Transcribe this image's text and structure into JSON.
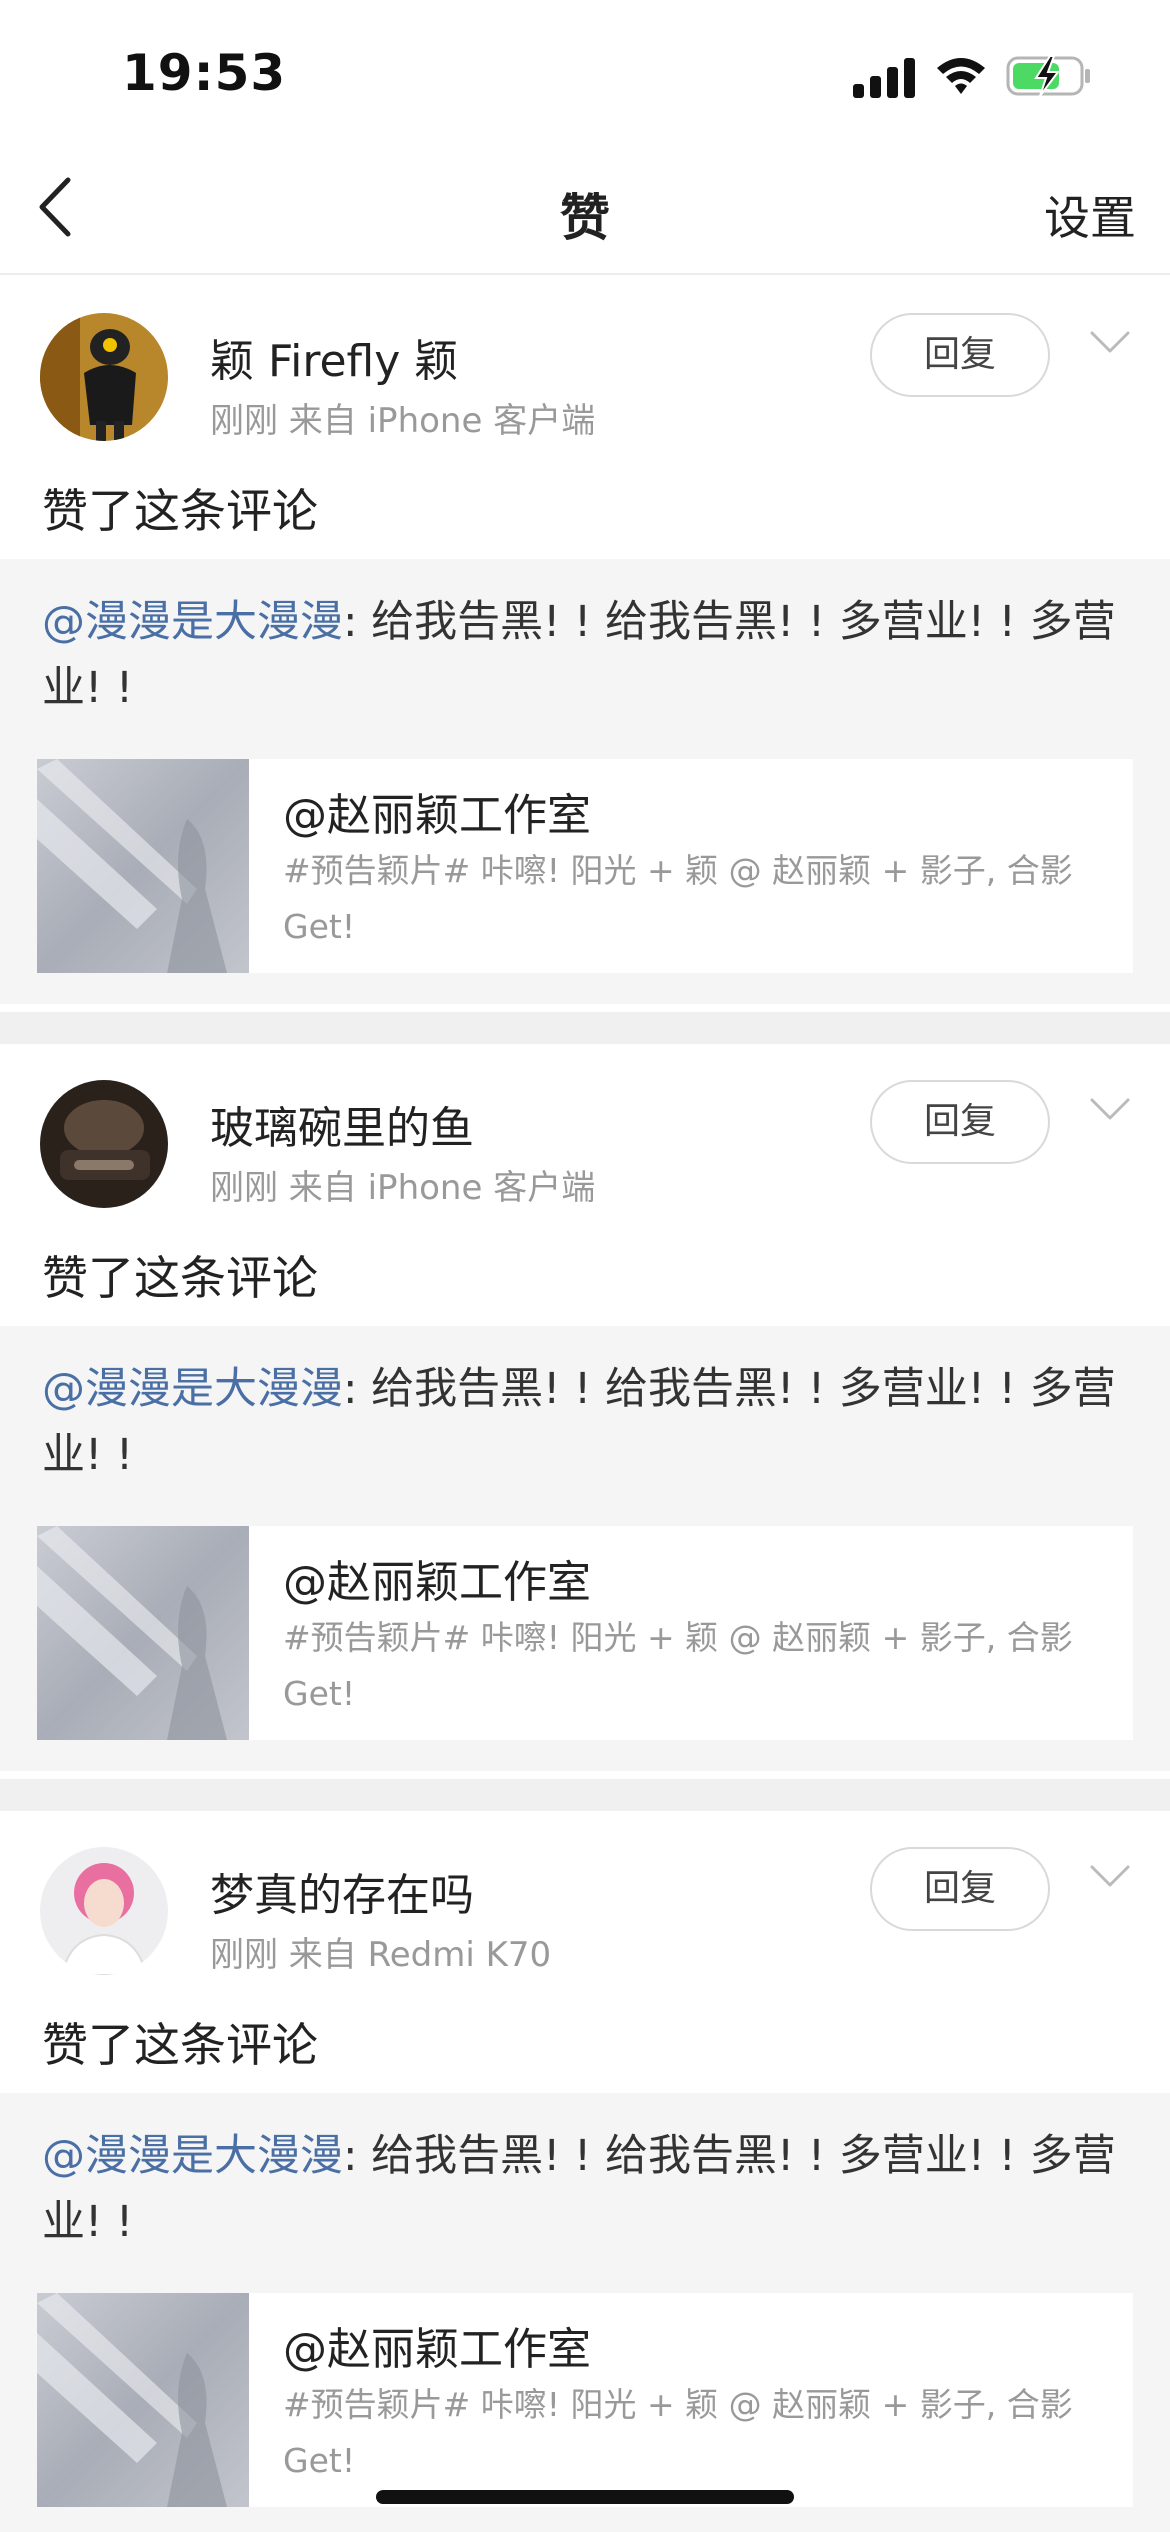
{
  "status_bar": {
    "time": "19:53"
  },
  "nav": {
    "title": "赞",
    "settings_label": "设置"
  },
  "notifications": [
    {
      "user_name": "颖 Firefly 颖",
      "meta": "刚刚   来自 iPhone 客户端",
      "reply_label": "回复",
      "action": "赞了这条评论",
      "quote_mention": "@漫漫是大漫漫",
      "quote_text": ": 给我告黑! !  给我告黑! !  多营业! !  多营业! !",
      "post_title": "@赵丽颖工作室",
      "post_desc": "#预告颖片# 咔嚓! 阳光 + 颖 @ 赵丽颖 + 影子, 合影 Get!"
    },
    {
      "user_name": "玻璃碗里的鱼",
      "meta": "刚刚   来自 iPhone 客户端",
      "reply_label": "回复",
      "action": "赞了这条评论",
      "quote_mention": "@漫漫是大漫漫",
      "quote_text": ": 给我告黑! !  给我告黑! !  多营业! !  多营业! !",
      "post_title": "@赵丽颖工作室",
      "post_desc": "#预告颖片# 咔嚓! 阳光 + 颖 @ 赵丽颖 + 影子, 合影 Get!"
    },
    {
      "user_name": "梦真的存在吗",
      "meta": "刚刚   来自 Redmi K70",
      "reply_label": "回复",
      "action": "赞了这条评论",
      "quote_mention": "@漫漫是大漫漫",
      "quote_text": ": 给我告黑! !  给我告黑! !  多营业! !  多营业! !",
      "post_title": "@赵丽颖工作室",
      "post_desc": "#预告颖片# 咔嚓! 阳光 + 颖 @ 赵丽颖 + 影子, 合影 Get!"
    }
  ],
  "colors": {
    "mention": "#4a6fa5",
    "meta": "#999999",
    "battery_fill": "#4cd964"
  }
}
